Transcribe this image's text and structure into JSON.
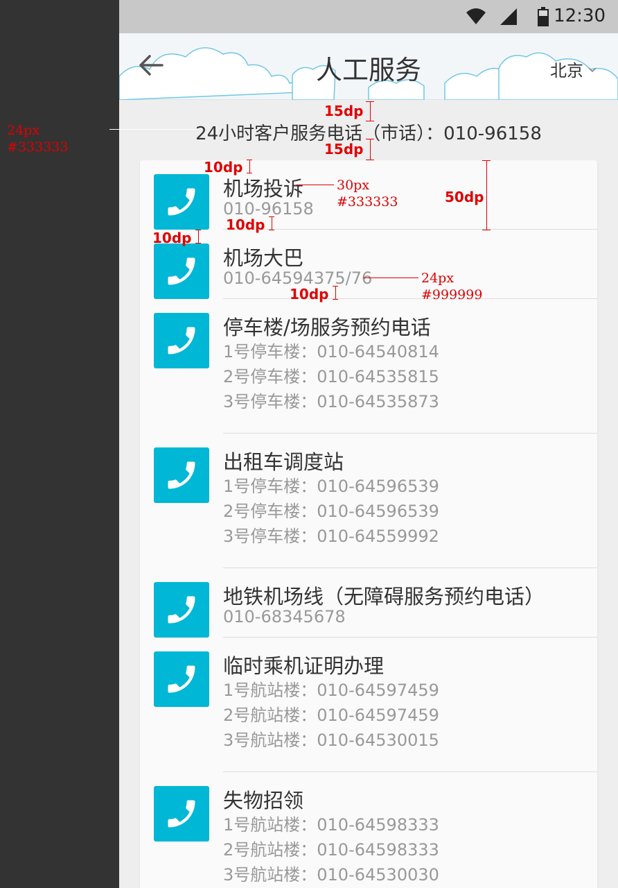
{
  "status_bar": {
    "time": "12:30",
    "icons": [
      "wifi-icon",
      "signal-icon",
      "battery-icon"
    ]
  },
  "header": {
    "back_icon": "arrow-left-icon",
    "title": "人工服务",
    "city": "北京",
    "city_icon": "chevron-down-icon"
  },
  "hotline": {
    "text": "24小时客户服务电话（市话）：010-96158"
  },
  "items": [
    {
      "title": "机场投诉",
      "lines": [
        "010-96158"
      ]
    },
    {
      "title": "机场大巴",
      "lines": [
        "010-64594375/76"
      ]
    },
    {
      "title": "停车楼/场服务预约电话",
      "lines": [
        "1号停车楼：010-64540814",
        "2号停车楼：010-64535815",
        "3号停车楼：010-64535873"
      ]
    },
    {
      "title": "出租车调度站",
      "lines": [
        "1号停车楼：010-64596539",
        "2号停车楼：010-64596539",
        "3号停车楼：010-64559992"
      ]
    },
    {
      "title": "地铁机场线（无障碍服务预约电话）",
      "lines": [
        "010-68345678"
      ]
    },
    {
      "title": "临时乘机证明办理",
      "lines": [
        "1号航站楼：010-64597459",
        "2号航站楼：010-64597459",
        "3号航站楼：010-64530015"
      ]
    },
    {
      "title": "失物招领",
      "lines": [
        "1号航站楼：010-64598333",
        "2号航站楼：010-64598333",
        "3号航站楼：010-64530030"
      ]
    }
  ],
  "annotations": {
    "hotline_size": "24px",
    "hotline_color": "#333333",
    "gap_top": "15dp",
    "gap_bottom": "15dp",
    "card_pad": "10dp",
    "title_size": "30px",
    "title_color": "#333333",
    "row_height": "50dp",
    "sub_gap": "10dp",
    "icon_gap": "10dp",
    "sub_size": "24px",
    "sub_color": "#999999",
    "sub_gap2": "10dp"
  },
  "colors": {
    "accent": "#00b7d6",
    "text_primary": "#333333",
    "text_secondary": "#999999"
  }
}
